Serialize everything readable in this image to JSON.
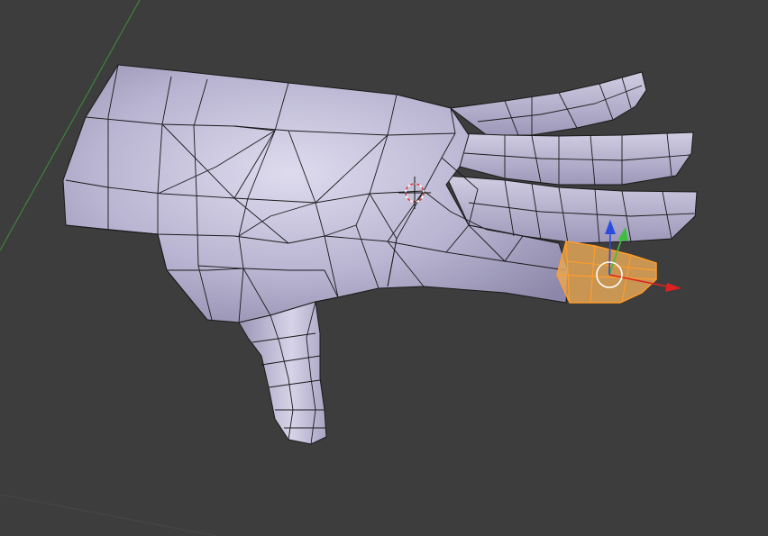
{
  "viewport": {
    "background": "#3d3d3d",
    "axis_y_color": "#3f8f3f",
    "grid_color": "#474747"
  },
  "mesh": {
    "fill": "#b4b0cc",
    "fill_light": "#dcd9ea",
    "fill_shadow": "#8e8aa8",
    "edge_color": "#1a1a1a"
  },
  "selection": {
    "fill": "#e8a040",
    "edge_color": "#ff9d2a"
  },
  "gizmo": {
    "x_color": "#e02020",
    "y_color": "#3cc03c",
    "z_color": "#2a4ce0",
    "center_color": "#ffffff"
  },
  "cursor_3d": {
    "ring_color": "#e04040",
    "crosshair_color": "#111111"
  }
}
